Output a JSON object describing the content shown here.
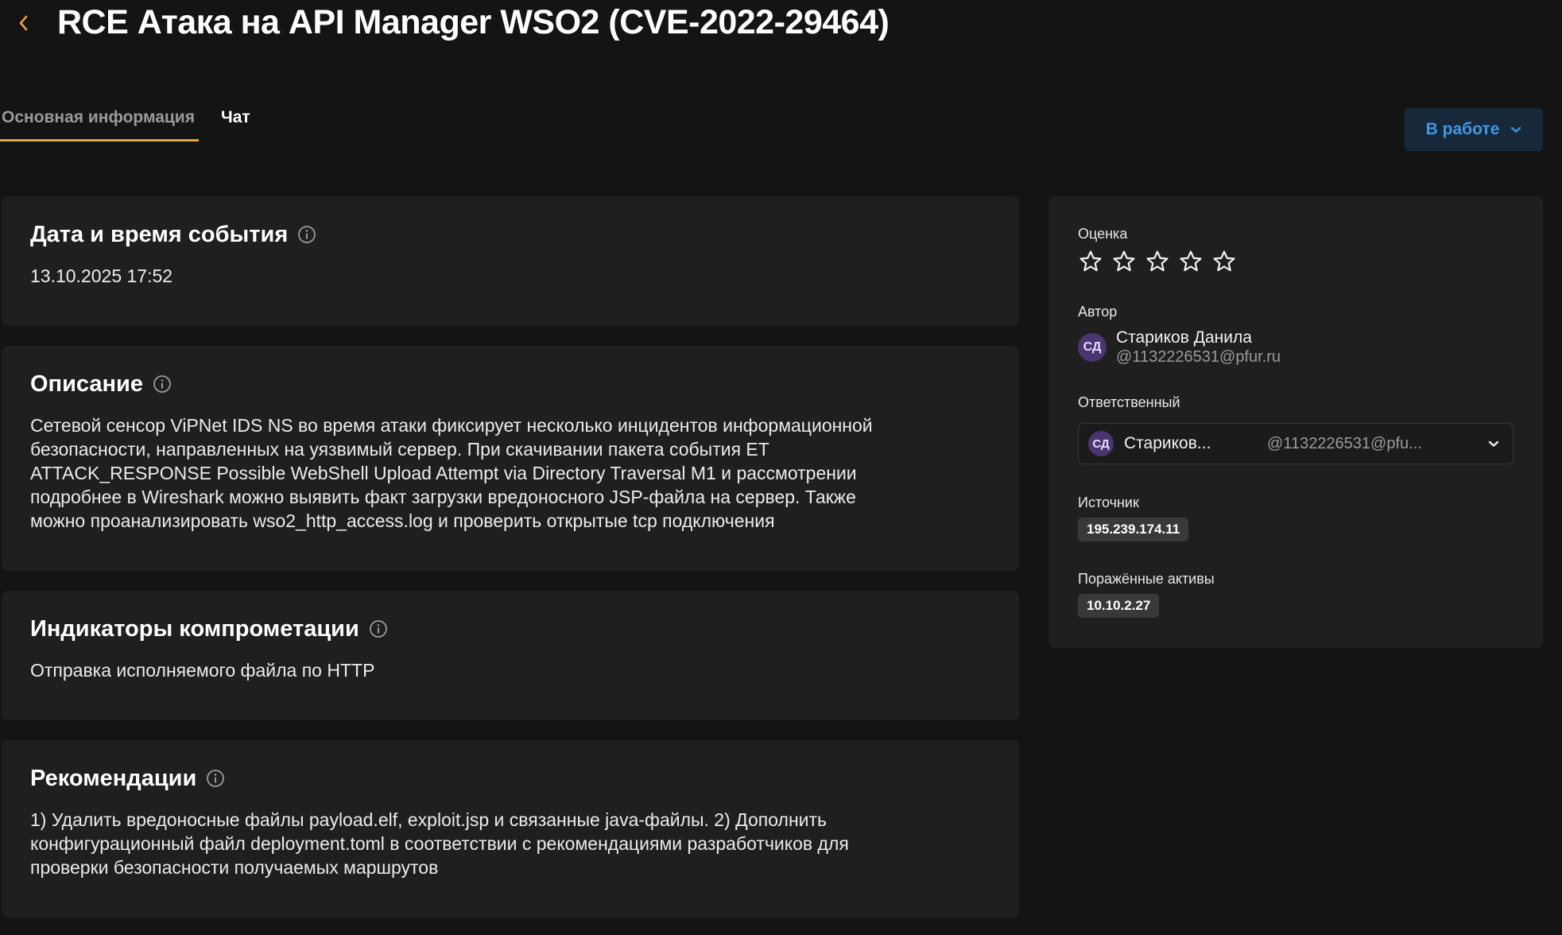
{
  "header": {
    "back_icon": "chevron-left-icon",
    "title": "RCE Атака на API Manager WSO2 (CVE-2022-29464)"
  },
  "tabs": [
    {
      "label": "Основная информация",
      "active": true
    },
    {
      "label": "Чат",
      "active": false
    }
  ],
  "status": {
    "label": "В работе",
    "icon": "chevron-down-icon"
  },
  "sections": {
    "datetime": {
      "title": "Дата и время события",
      "value": "13.10.2025 17:52"
    },
    "description": {
      "title": "Описание",
      "lines": [
        "Сетевой сенсор ViPNet IDS NS во время атаки фиксирует несколько инцидентов информационной",
        "безопасности, направленных на уязвимый сервер. При скачивании пакета события ET",
        "ATTACK_RESPONSE Possible WebShell Upload Attempt via Directory Traversal M1 и рассмотрении",
        "подробнее в Wireshark можно выявить факт загрузки вредоносного JSP-файла на сервер. Также",
        "можно проанализировать wso2_http_access.log и проверить открытые tcp подключения"
      ]
    },
    "indicators": {
      "title": "Индикаторы компрометации",
      "value": "Отправка исполняемого файла по HTTP"
    },
    "recommendations": {
      "title": "Рекомендации",
      "lines": [
        "1) Удалить вредоносные файлы payload.elf, exploit.jsp и связанные java-файлы. 2) Дополнить",
        "конфигурационный файл deployment.toml в соответствии с рекомендациями разработчиков для",
        "проверки безопасности получаемых маршрутов"
      ]
    }
  },
  "sidebar": {
    "rating": {
      "label": "Оценка",
      "value": 0,
      "max": 5
    },
    "author": {
      "label": "Автор",
      "initials": "СД",
      "name": "Стариков Данила",
      "login": "@1132226531@pfur.ru"
    },
    "assignee": {
      "label": "Ответственный",
      "initials": "СД",
      "name": "Стариков...",
      "login": "@1132226531@pfu..."
    },
    "source": {
      "label": "Источник",
      "value": "195.239.174.11"
    },
    "assets": {
      "label": "Поражённые активы",
      "value": "10.10.2.27"
    }
  },
  "colors": {
    "background": "#141414",
    "card": "#1f1f1f",
    "accent": "#e8a33a",
    "status_text": "#3f97e6",
    "status_bg": "#17283a",
    "avatar_bg": "#4b3570"
  }
}
